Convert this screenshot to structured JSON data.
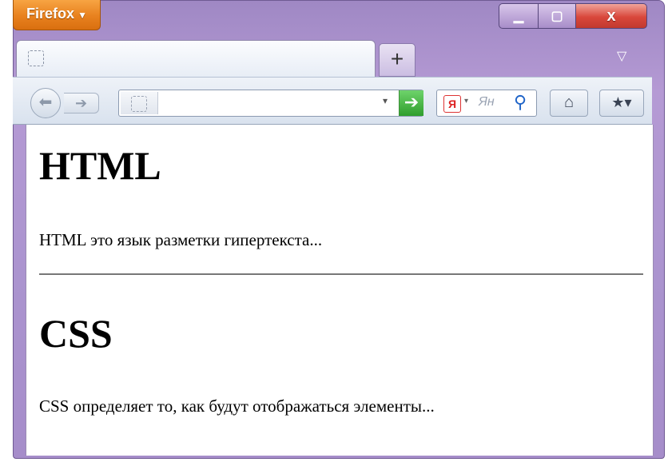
{
  "titlebar": {
    "menu_label": "Firefox",
    "menu_caret": "▼"
  },
  "window_controls": {
    "minimize": "▁",
    "maximize": "▢",
    "close": "x"
  },
  "tabbar": {
    "new_tab": "+",
    "list_tabs": "▽"
  },
  "toolbar": {
    "back": "⬅",
    "forward": "➔",
    "url_dropdown": "▾",
    "go": "➔",
    "search_engine_badge": "Я",
    "search_engine_caret": "▾",
    "search_hint": "Ян",
    "search_button": "⚲",
    "home": "⌂",
    "bookmarks": "★▾"
  },
  "page": {
    "heading1": "HTML",
    "paragraph1": "HTML это язык разметки гипертекста...",
    "heading2": "CSS",
    "paragraph2": "CSS определяет то, как будут отображаться элементы..."
  },
  "colors": {
    "window_frame": "#ab94cf",
    "firefox_button": "#e8811e",
    "close_button": "#d9473b",
    "go_button": "#2f9e2c"
  }
}
